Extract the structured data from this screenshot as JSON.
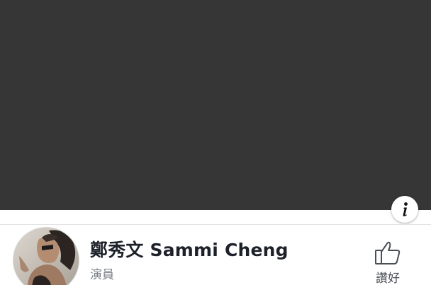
{
  "page": {
    "name": "鄭秀文 Sammi Cheng",
    "category": "演員"
  },
  "actions": {
    "like_label": "讚好",
    "info_icon": "info-icon",
    "like_icon": "thumbs-up-icon"
  },
  "colors": {
    "cover": "#363636",
    "name_text": "#1d2129",
    "category_text": "#7a7f87"
  }
}
